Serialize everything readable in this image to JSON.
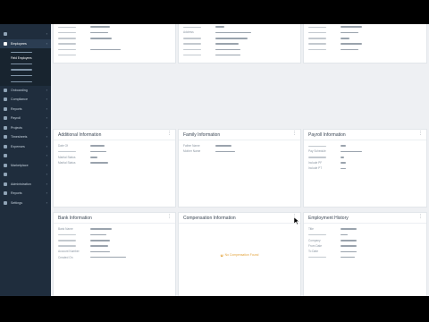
{
  "sidebar": {
    "items": [
      {
        "label": "",
        "icon": "dashboard-icon"
      },
      {
        "label": "Employees",
        "icon": "people-icon",
        "active": true,
        "sub": [
          {
            "label": ""
          },
          {
            "label": "Field Employees",
            "active": true
          },
          {
            "label": ""
          },
          {
            "label": ""
          },
          {
            "label": ""
          },
          {
            "label": ""
          }
        ]
      },
      {
        "label": "Onboarding",
        "icon": "onboarding-icon"
      },
      {
        "label": "Compliance",
        "icon": "compliance-icon"
      },
      {
        "label": "Reports",
        "icon": "reports-icon"
      },
      {
        "label": "Payroll",
        "icon": "payroll-icon"
      },
      {
        "label": "Projects",
        "icon": "projects-icon"
      },
      {
        "label": "Timesheets",
        "icon": "timesheet-icon"
      },
      {
        "label": "Expenses",
        "icon": "expenses-icon"
      },
      {
        "label": "",
        "icon": "ats-icon"
      },
      {
        "label": "Marketplace",
        "icon": "marketplace-icon"
      },
      {
        "label": "",
        "icon": "leave-icon"
      },
      {
        "label": "Administration",
        "icon": "admin-icon"
      },
      {
        "label": "Reports",
        "icon": "reports2-icon"
      },
      {
        "label": "Settings",
        "icon": "settings-icon"
      }
    ]
  },
  "cards": {
    "top_left": {
      "rows": [
        {
          "k": "",
          "w": 22
        },
        {
          "k": "",
          "w": 20
        },
        {
          "k": "",
          "w": 24
        },
        {
          "k": "",
          "w": 0
        },
        {
          "k": "",
          "w": 34
        },
        {
          "k": "",
          "w": 0
        }
      ]
    },
    "top_mid": {
      "rows": [
        {
          "k": "",
          "w": 10
        },
        {
          "k": "Address",
          "w": 40
        },
        {
          "k": "",
          "w": 36
        },
        {
          "k": "",
          "w": 26
        },
        {
          "k": "",
          "w": 28
        },
        {
          "k": "",
          "w": 28
        }
      ]
    },
    "top_right": {
      "rows": [
        {
          "k": "",
          "w": 24
        },
        {
          "k": "",
          "w": 20
        },
        {
          "k": "",
          "w": 10
        },
        {
          "k": "",
          "w": 24
        },
        {
          "k": "",
          "w": 20
        }
      ]
    },
    "additional": {
      "title": "Additional Information",
      "rows": [
        {
          "k": "Date Of",
          "w": 16
        },
        {
          "k": "",
          "w": 18
        },
        {
          "k": "Marital Status",
          "w": 8
        },
        {
          "k": "Marital Status",
          "w": 20
        }
      ]
    },
    "family": {
      "title": "Family Information",
      "rows": [
        {
          "k": "Father Name",
          "w": 18
        },
        {
          "k": "Mother Name",
          "w": 22
        }
      ]
    },
    "payroll": {
      "title": "Payroll Information",
      "rows": [
        {
          "k": "",
          "w": 6
        },
        {
          "k": "Pay Schedule",
          "w": 24
        },
        {
          "k": "",
          "w": 4
        },
        {
          "k": "Include PF",
          "w": 6
        },
        {
          "k": "Include PT",
          "w": 6
        }
      ]
    },
    "bank": {
      "title": "Bank Information",
      "rows": [
        {
          "k": "Bank Name",
          "w": 24
        },
        {
          "k": "",
          "w": 18
        },
        {
          "k": "",
          "w": 22
        },
        {
          "k": "",
          "w": 20
        },
        {
          "k": "Account Number",
          "w": 22
        },
        {
          "k": "Created On",
          "w": 40
        }
      ]
    },
    "compensation": {
      "title": "Compensation Information",
      "loading": "No Compensation Found"
    },
    "employment": {
      "title": "Employment History",
      "rows": [
        {
          "k": "Title",
          "w": 18
        },
        {
          "k": "",
          "w": 8
        },
        {
          "k": "Company",
          "w": 18
        },
        {
          "k": "From Date",
          "w": 18
        },
        {
          "k": "To Date",
          "w": 18
        },
        {
          "k": "",
          "w": 16
        }
      ]
    }
  },
  "colors": {
    "sidebar_bg": "#1f2d3d",
    "page_bg": "#eef0f3",
    "card_bg": "#ffffff",
    "loading": "#e3a33b"
  }
}
